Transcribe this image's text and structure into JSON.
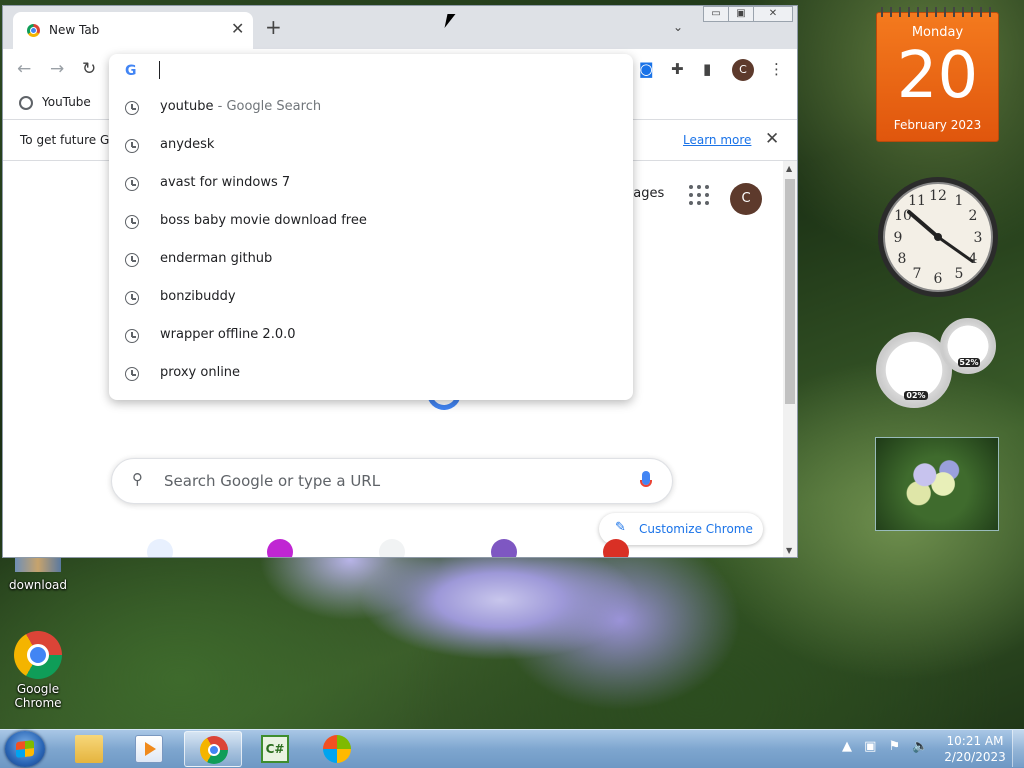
{
  "browser": {
    "tab_title": "New Tab",
    "tab_close": "✕",
    "new_tab": "+",
    "tab_search": "⌄",
    "window_controls": [
      "▭",
      "▣",
      "✕"
    ],
    "nav": {
      "back": "←",
      "forward": "→",
      "reload": "↻"
    },
    "profile_initial": "C",
    "menu": "⋮"
  },
  "bookmarks": [
    {
      "label": "YouTube"
    }
  ],
  "infobar": {
    "text": "To get future G",
    "learn_more": "Learn more",
    "close": "✕"
  },
  "omnibox": {
    "input_value": "",
    "suggestions": [
      {
        "text": "youtube",
        "suffix": " - Google Search"
      },
      {
        "text": "anydesk",
        "suffix": ""
      },
      {
        "text": "avast for windows 7",
        "suffix": ""
      },
      {
        "text": "boss baby movie download free",
        "suffix": ""
      },
      {
        "text": "enderman github",
        "suffix": ""
      },
      {
        "text": "bonzibuddy",
        "suffix": ""
      },
      {
        "text": "wrapper offline 2.0.0",
        "suffix": ""
      },
      {
        "text": "proxy online",
        "suffix": ""
      }
    ]
  },
  "newtab": {
    "images_link": "nages",
    "avatar_initial": "C",
    "search_placeholder": "Search Google or type a URL",
    "customize_label": "Customize Chrome"
  },
  "gadgets": {
    "calendar": {
      "weekday": "Monday",
      "day": "20",
      "month_year": "February 2023"
    },
    "cpu_meter": {
      "cpu": "02%",
      "memory": "52%"
    }
  },
  "desktop_icons": [
    {
      "label": "download"
    },
    {
      "label": "Google\nChrome"
    }
  ],
  "taskbar": {
    "time": "10:21 AM",
    "date": "2/20/2023",
    "csharp_label": "C#"
  }
}
